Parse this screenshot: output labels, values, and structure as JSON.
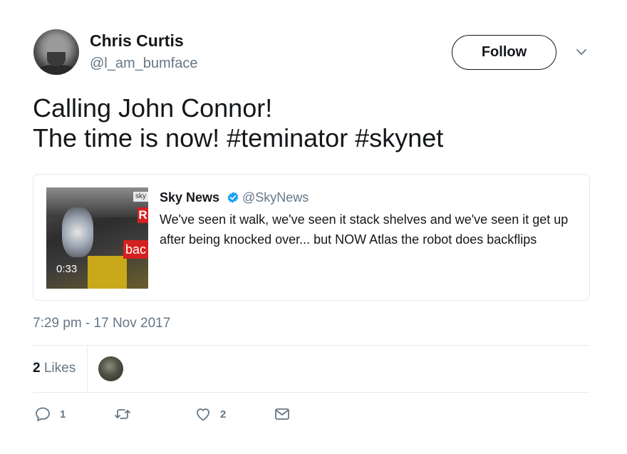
{
  "author": {
    "display_name": "Chris Curtis",
    "handle": "@l_am_bumface"
  },
  "follow_label": "Follow",
  "tweet": {
    "line1": "Calling John Connor!",
    "line2": "The time is now! #teminator #skynet",
    "timestamp": "7:29 pm - 17 Nov 2017"
  },
  "quoted": {
    "name": "Sky News",
    "handle": "@SkyNews",
    "text": "We've seen it walk, we've seen it stack shelves and we've seen it get up after being knocked over... but NOW Atlas the robot does backflips",
    "media": {
      "duration": "0:33",
      "logo_text": "sky",
      "overlay_text_1": "R",
      "overlay_text_2": "bac"
    }
  },
  "stats": {
    "likes_count": "2",
    "likes_label": "Likes"
  },
  "actions": {
    "reply_count": "1",
    "retweet_count": "",
    "like_count": "2"
  },
  "icons": [
    "chevron-down-icon",
    "verified-badge-icon",
    "reply-icon",
    "retweet-icon",
    "heart-icon",
    "envelope-icon"
  ],
  "colors": {
    "text": "#14171a",
    "secondary": "#657786",
    "verified": "#1da1f2",
    "border": "#e1e8ed"
  }
}
